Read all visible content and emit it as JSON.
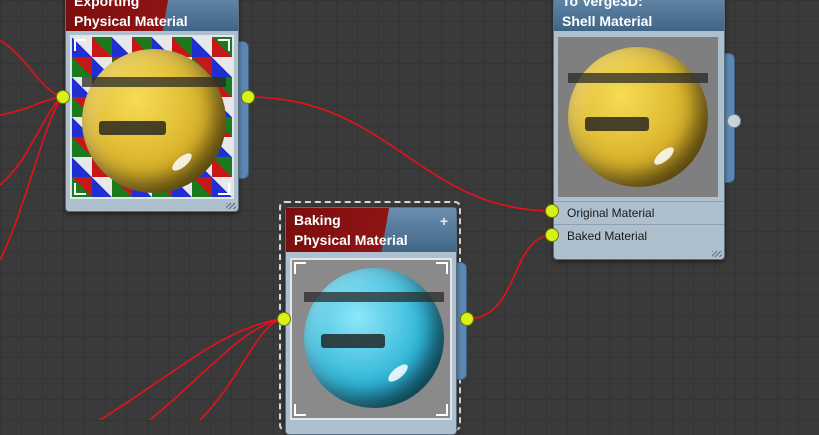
{
  "colors": {
    "wire": "#e8101a",
    "socket": "#d9f01a",
    "header_red": "#8f1414",
    "header_blue": "#4a7092"
  },
  "nodes": {
    "export": {
      "title_line1": "Exporting",
      "title_line2": "Physical Material"
    },
    "baking": {
      "title_line1": "Baking",
      "title_line2": "Physical Material",
      "plus_icon": "+"
    },
    "shell": {
      "title_line1": "To Verge3D:",
      "title_line2": "Shell Material",
      "inputs": [
        {
          "label": "Original Material"
        },
        {
          "label": "Baked Material"
        }
      ]
    }
  }
}
